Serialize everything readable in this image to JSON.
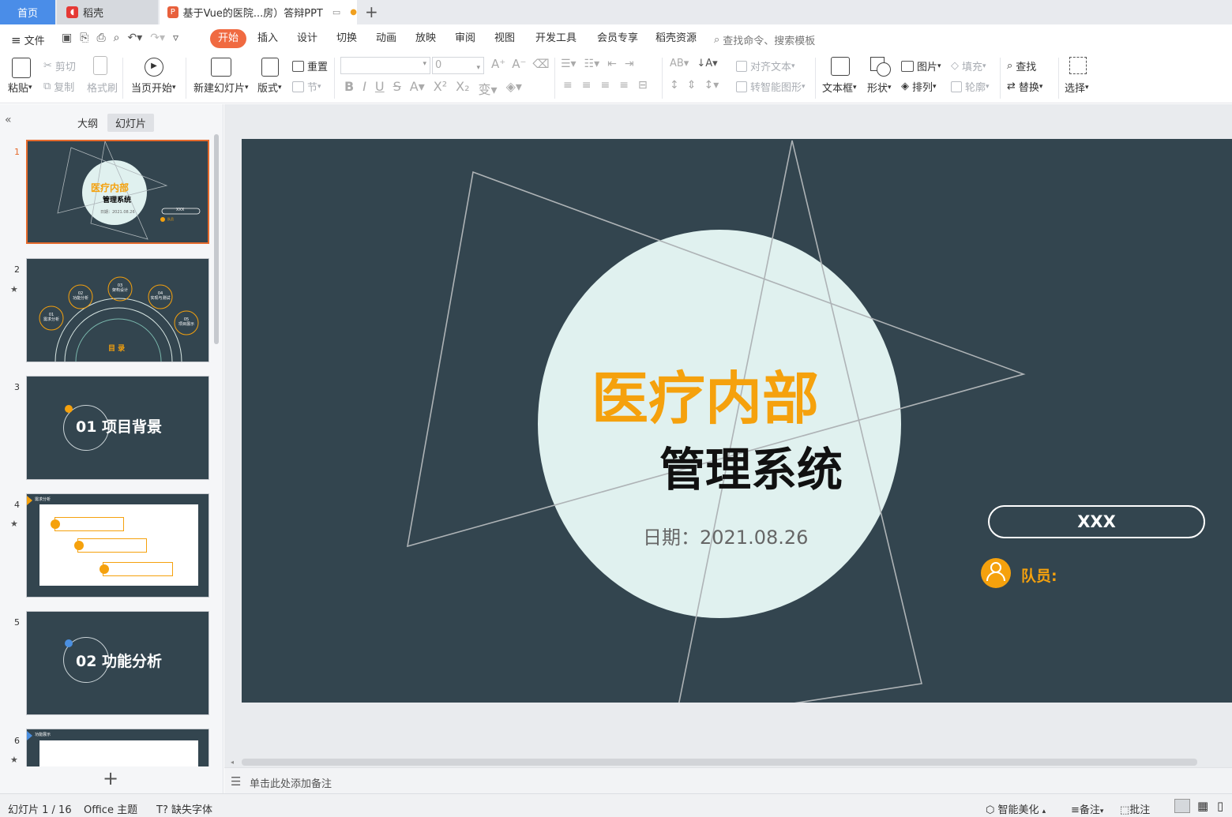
{
  "tabs": {
    "home": "首页",
    "daoke": "稻壳",
    "doc": "基于Vue的医院...房）答辩PPT"
  },
  "ribbon": {
    "file": "文件",
    "items": [
      "开始",
      "插入",
      "设计",
      "切换",
      "动画",
      "放映",
      "审阅",
      "视图",
      "开发工具",
      "会员专享",
      "稻壳资源"
    ],
    "search": "查找命令、搜索模板"
  },
  "toolbar": {
    "paste": "粘贴",
    "cut": "剪切",
    "copy": "复制",
    "format_painter": "格式刷",
    "from_current": "当页开始",
    "new_slide": "新建幻灯片",
    "layout": "版式",
    "reset": "重置",
    "section": "节",
    "font_size": "0",
    "align_text": "对齐文本",
    "smart_art": "转智能图形",
    "textbox": "文本框",
    "shape": "形状",
    "picture": "图片",
    "arrange": "排列",
    "fill": "填充",
    "outline": "轮廓",
    "find": "查找",
    "replace": "替换",
    "select": "选择"
  },
  "panel": {
    "outline_tab": "大纲",
    "slides_tab": "幻灯片",
    "numbers": [
      "1",
      "2",
      "3",
      "4",
      "5",
      "6"
    ]
  },
  "thumbs": {
    "t1_title": "医疗内部",
    "t1_sub": "管理系统",
    "t1_date": "日期：2021.08.26",
    "t1_box": "XXX",
    "t1_member": "队员",
    "t2_items": [
      "01\n需求分析",
      "02\n功能分析",
      "03\n架构设计",
      "04\n实现与测试",
      "05\n项目展示"
    ],
    "t2_title": "目 录",
    "t3_title": "01 项目背景",
    "t4_header": "需求分析",
    "t5_title": "02 功能分析",
    "t6_header": "功能展示"
  },
  "slide": {
    "title": "医疗内部",
    "subtitle": "管理系统",
    "date": "日期：2021.08.26",
    "box": "XXX",
    "member": "队员:"
  },
  "notes": {
    "placeholder": "单击此处添加备注"
  },
  "status": {
    "slide_count": "幻灯片 1 / 16",
    "theme": "Office 主题",
    "missing_font": "缺失字体",
    "beautify": "智能美化",
    "notes": "备注",
    "comment": "批注"
  },
  "colors": {
    "accent": "#f06a41",
    "slide_bg": "#33454f",
    "circle": "#e0f1ef",
    "orange": "#f5a10d"
  }
}
